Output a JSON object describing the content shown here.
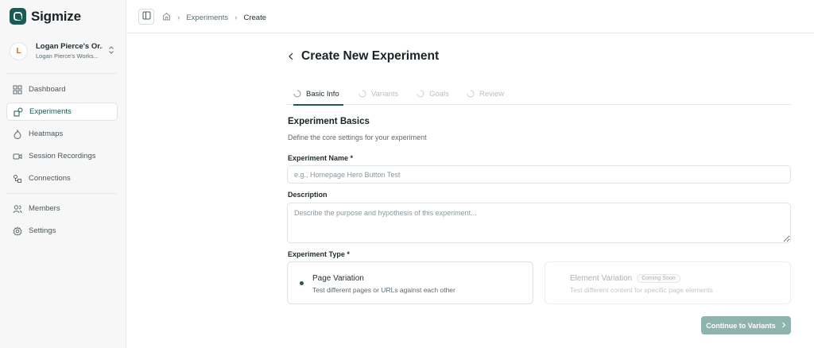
{
  "app": {
    "name": "Sigmize"
  },
  "org": {
    "avatar_letter": "L",
    "name": "Logan Pierce's Or...",
    "workspace": "Logan Pierce's Works..."
  },
  "sidebar": {
    "items": [
      {
        "label": "Dashboard",
        "icon": "dashboard-grid-icon",
        "active": false
      },
      {
        "label": "Experiments",
        "icon": "experiments-shapes-icon",
        "active": true
      },
      {
        "label": "Heatmaps",
        "icon": "flame-icon",
        "active": false
      },
      {
        "label": "Session Recordings",
        "icon": "video-camera-icon",
        "active": false
      },
      {
        "label": "Connections",
        "icon": "connections-icon",
        "active": false
      },
      {
        "label": "Members",
        "icon": "members-icon",
        "active": false
      },
      {
        "label": "Settings",
        "icon": "gear-icon",
        "active": false
      }
    ]
  },
  "breadcrumb": {
    "home_icon": "home-icon",
    "items": [
      "Experiments",
      "Create"
    ]
  },
  "page": {
    "title": "Create New Experiment"
  },
  "tabs": [
    {
      "label": "Basic Info",
      "active": true
    },
    {
      "label": "Variants",
      "active": false
    },
    {
      "label": "Goals",
      "active": false
    },
    {
      "label": "Review",
      "active": false
    }
  ],
  "section": {
    "title": "Experiment Basics",
    "subtitle": "Define the core settings for your experiment"
  },
  "fields": {
    "name": {
      "label": "Experiment Name *",
      "value": "",
      "placeholder": "e.g., Homepage Hero Button Test"
    },
    "description": {
      "label": "Description",
      "value": "",
      "placeholder": "Describe the purpose and hypothesis of this experiment..."
    },
    "type": {
      "label": "Experiment Type *",
      "options": [
        {
          "title": "Page Variation",
          "description": "Test different pages or URLs against each other",
          "selected": true,
          "disabled": false
        },
        {
          "title": "Element Variation",
          "badge": "Coming Soon",
          "description": "Test different content for specific page elements",
          "selected": false,
          "disabled": true
        }
      ]
    }
  },
  "actions": {
    "continue_label": "Continue to Variants"
  },
  "colors": {
    "brand": "#1c5a55",
    "button_disabled": "#8fb3ae",
    "avatar_letter": "#e0661f"
  }
}
